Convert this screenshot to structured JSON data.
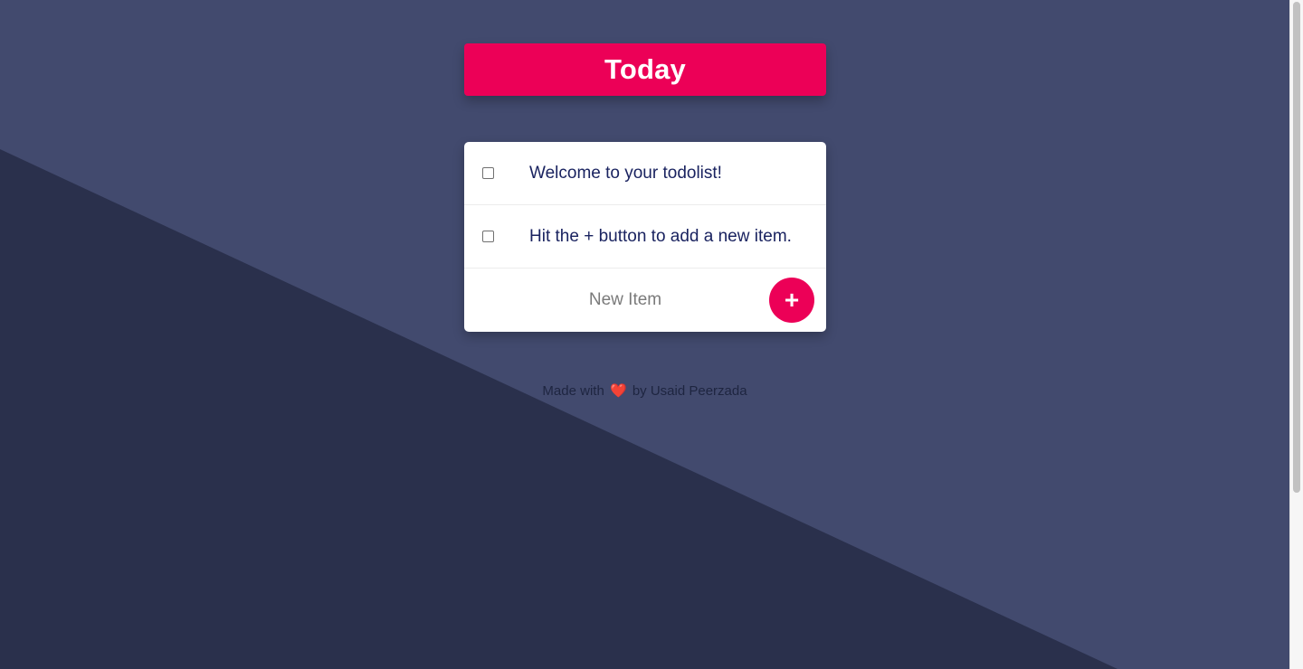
{
  "header": {
    "title": "Today"
  },
  "todo": {
    "items": [
      {
        "text": "Welcome to your todolist!",
        "checked": false
      },
      {
        "text": "Hit the + button to add a new item.",
        "checked": false
      }
    ],
    "new_item": {
      "placeholder": "New Item",
      "value": ""
    },
    "add_button_label": "+"
  },
  "footer": {
    "prefix": "Made with",
    "heart": "❤️",
    "suffix": "by Usaid Peerzada"
  },
  "colors": {
    "background": "#424a6e",
    "background_dark": "#2a304c",
    "accent": "#ec0057",
    "item_text": "#1a2360",
    "card": "#ffffff"
  }
}
